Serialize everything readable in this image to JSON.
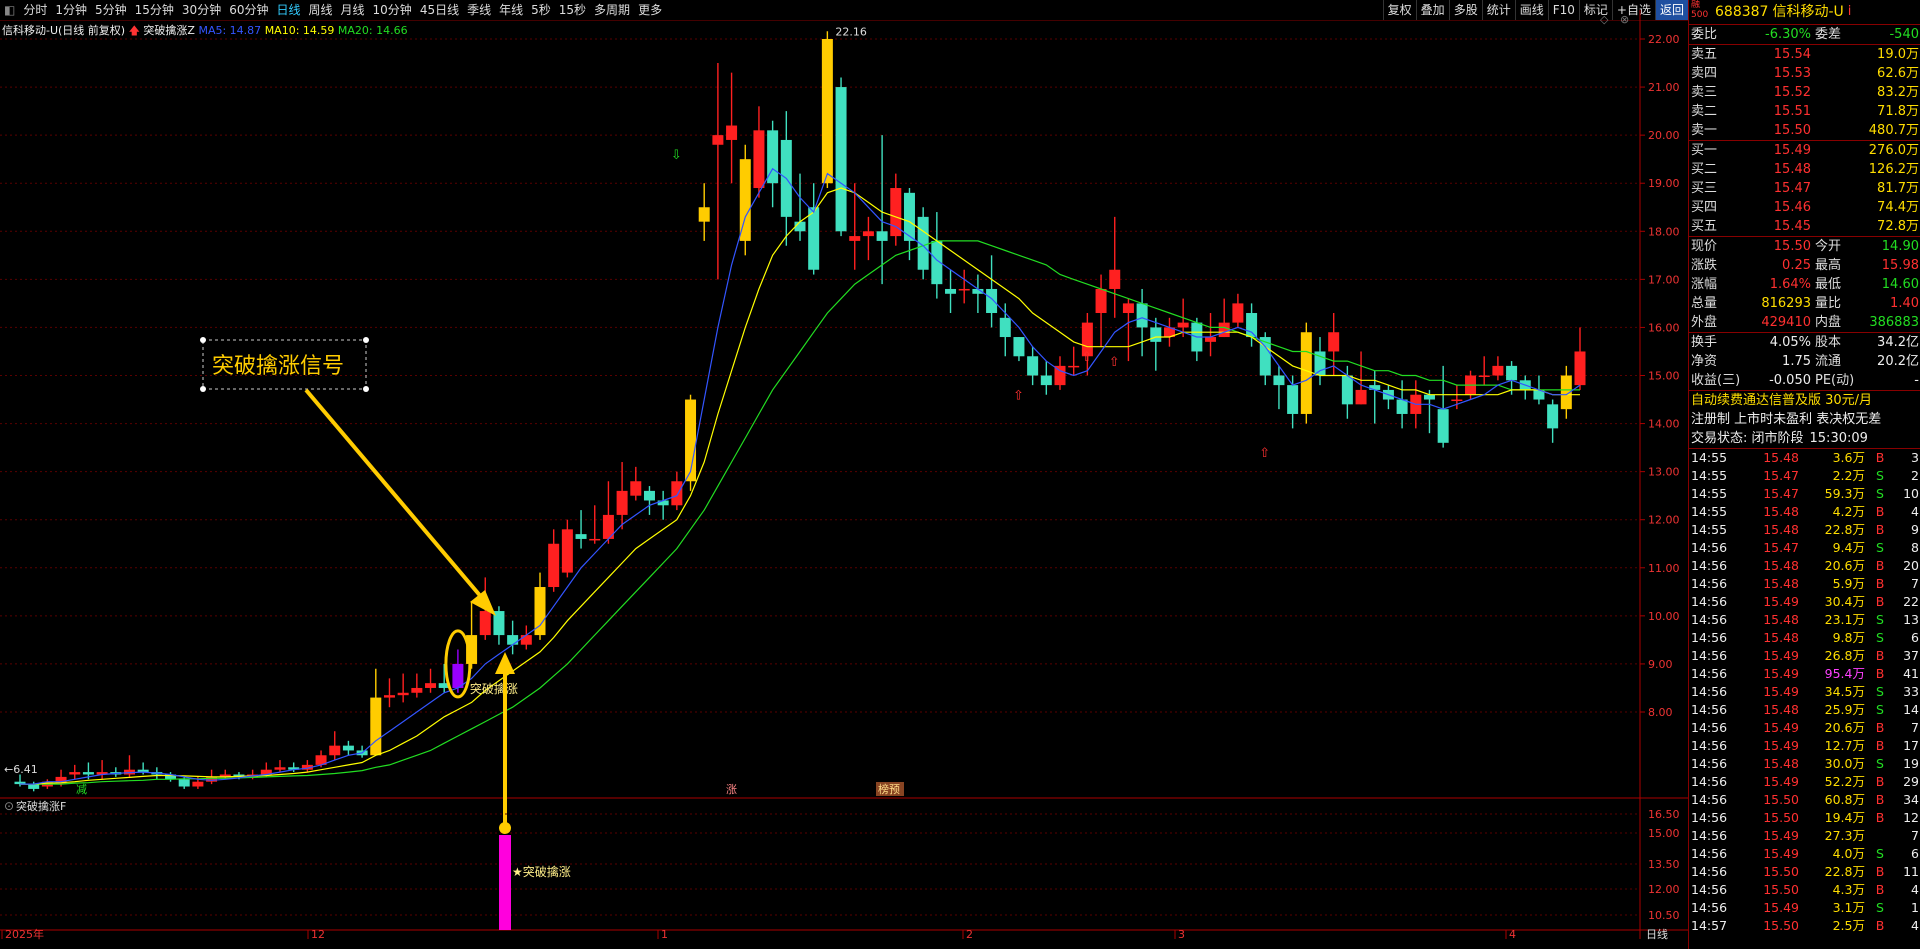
{
  "toolbar": {
    "tabs": [
      "分时",
      "1分钟",
      "5分钟",
      "15分钟",
      "30分钟",
      "60分钟",
      "日线",
      "周线",
      "月线",
      "10分钟",
      "45日线",
      "季线",
      "年线",
      "5秒",
      "15秒",
      "多周期",
      "更多"
    ],
    "active_tab": "日线",
    "right_buttons": [
      "复权",
      "叠加",
      "多股",
      "统计",
      "画线",
      "F10",
      "标记",
      "+自选",
      "返回"
    ]
  },
  "legend": {
    "title": "信科移动-U(日线 前复权)",
    "indicator": "突破擒涨Z",
    "ma5": "MA5: 14.87",
    "ma10": "MA10: 14.59",
    "ma20": "MA20: 14.66",
    "colors": {
      "ma5": "#3355ff",
      "ma10": "#ffff00",
      "ma20": "#22dd22"
    }
  },
  "chart_data": {
    "type": "candlestick",
    "y_ticks": [
      "22.00",
      "21.00",
      "20.00",
      "19.00",
      "18.00",
      "17.00",
      "16.00",
      "15.00",
      "14.00",
      "13.00",
      "12.00",
      "11.00",
      "10.00",
      "9.00",
      "8.00"
    ],
    "ylim": [
      7.0,
      22.3
    ],
    "x_labels": [
      "2025年",
      "12",
      "1",
      "2",
      "3",
      "4"
    ],
    "high_label": "22.16",
    "low_label": "6.41",
    "annotation_box": "突破擒涨信号",
    "signal_label": "突破擒涨",
    "bottom_markers": [
      "减",
      "涨",
      "榜预"
    ],
    "candles": [
      [
        6.55,
        6.5,
        6.45,
        6.7
      ],
      [
        6.5,
        6.4,
        6.35,
        6.55
      ],
      [
        6.45,
        6.55,
        6.4,
        6.6
      ],
      [
        6.5,
        6.65,
        6.45,
        6.8
      ],
      [
        6.7,
        6.75,
        6.6,
        6.9
      ],
      [
        6.75,
        6.7,
        6.6,
        6.95
      ],
      [
        6.7,
        6.75,
        6.6,
        7.0
      ],
      [
        6.75,
        6.7,
        6.65,
        6.85
      ],
      [
        6.7,
        6.8,
        6.65,
        7.1
      ],
      [
        6.8,
        6.75,
        6.7,
        6.95
      ],
      [
        6.75,
        6.7,
        6.6,
        6.85
      ],
      [
        6.7,
        6.6,
        6.55,
        6.75
      ],
      [
        6.6,
        6.45,
        6.4,
        6.65
      ],
      [
        6.45,
        6.55,
        6.4,
        6.65
      ],
      [
        6.55,
        6.65,
        6.5,
        6.8
      ],
      [
        6.65,
        6.7,
        6.6,
        6.8
      ],
      [
        6.7,
        6.65,
        6.6,
        6.75
      ],
      [
        6.65,
        6.7,
        6.6,
        6.8
      ],
      [
        6.7,
        6.8,
        6.65,
        6.95
      ],
      [
        6.8,
        6.85,
        6.75,
        7.0
      ],
      [
        6.85,
        6.8,
        6.75,
        6.95
      ],
      [
        6.8,
        6.9,
        6.75,
        7.0
      ],
      [
        6.9,
        7.1,
        6.85,
        7.2
      ],
      [
        7.1,
        7.3,
        7.0,
        7.6
      ],
      [
        7.3,
        7.2,
        7.1,
        7.4
      ],
      [
        7.2,
        7.1,
        7.05,
        7.3
      ],
      [
        7.1,
        8.3,
        7.1,
        8.9
      ],
      [
        8.3,
        8.35,
        8.1,
        8.7
      ],
      [
        8.35,
        8.4,
        8.2,
        8.8
      ],
      [
        8.4,
        8.5,
        8.3,
        8.8
      ],
      [
        8.5,
        8.6,
        8.4,
        8.9
      ],
      [
        8.6,
        8.5,
        8.4,
        9.0
      ],
      [
        8.5,
        9.0,
        8.4,
        9.3
      ],
      [
        9.0,
        9.6,
        8.9,
        10.3
      ],
      [
        9.6,
        10.1,
        9.5,
        10.8
      ],
      [
        10.1,
        9.6,
        9.4,
        10.2
      ],
      [
        9.6,
        9.4,
        9.2,
        9.9
      ],
      [
        9.4,
        9.6,
        9.3,
        9.8
      ],
      [
        9.6,
        10.6,
        9.5,
        10.9
      ],
      [
        10.6,
        11.5,
        10.5,
        11.8
      ],
      [
        10.9,
        11.8,
        10.8,
        12.0
      ],
      [
        11.7,
        11.6,
        11.4,
        12.2
      ],
      [
        11.6,
        11.6,
        11.5,
        12.3
      ],
      [
        11.6,
        12.1,
        11.5,
        12.8
      ],
      [
        12.1,
        12.6,
        11.8,
        13.2
      ],
      [
        12.5,
        12.8,
        12.4,
        13.1
      ],
      [
        12.6,
        12.4,
        12.1,
        12.7
      ],
      [
        12.4,
        12.3,
        12.0,
        12.6
      ],
      [
        12.3,
        12.8,
        12.2,
        13.0
      ],
      [
        12.8,
        14.5,
        12.6,
        14.6
      ],
      [
        18.2,
        18.5,
        17.8,
        19.0
      ],
      [
        19.8,
        20.0,
        17.0,
        21.5
      ],
      [
        19.9,
        20.2,
        19.0,
        21.3
      ],
      [
        19.5,
        17.8,
        17.5,
        19.8
      ],
      [
        18.9,
        20.1,
        18.7,
        20.6
      ],
      [
        20.1,
        19.0,
        18.5,
        20.3
      ],
      [
        19.9,
        18.3,
        17.7,
        20.5
      ],
      [
        18.2,
        18.0,
        17.8,
        19.2
      ],
      [
        18.5,
        17.2,
        17.1,
        19.0
      ],
      [
        19.0,
        22.0,
        18.9,
        22.16
      ],
      [
        21.0,
        18.0,
        17.9,
        21.2
      ],
      [
        17.8,
        17.9,
        17.2,
        19.0
      ],
      [
        17.9,
        18.0,
        17.4,
        18.3
      ],
      [
        18.0,
        17.8,
        16.9,
        20.0
      ],
      [
        17.9,
        18.9,
        17.7,
        19.2
      ],
      [
        18.8,
        17.8,
        17.4,
        18.9
      ],
      [
        18.3,
        17.2,
        17.0,
        18.5
      ],
      [
        17.8,
        16.9,
        16.6,
        18.4
      ],
      [
        16.8,
        16.7,
        16.3,
        17.2
      ],
      [
        16.8,
        16.8,
        16.5,
        17.2
      ],
      [
        16.8,
        16.7,
        16.3,
        17.1
      ],
      [
        16.8,
        16.3,
        16.0,
        17.5
      ],
      [
        16.2,
        15.8,
        15.4,
        16.5
      ],
      [
        15.8,
        15.4,
        15.3,
        15.8
      ],
      [
        15.4,
        15.0,
        14.8,
        15.6
      ],
      [
        15.0,
        14.8,
        14.6,
        15.3
      ],
      [
        14.8,
        15.2,
        14.7,
        15.4
      ],
      [
        15.2,
        15.2,
        15.0,
        15.6
      ],
      [
        15.4,
        16.1,
        15.0,
        16.3
      ],
      [
        16.3,
        16.8,
        15.6,
        17.1
      ],
      [
        16.8,
        17.2,
        16.2,
        18.3
      ],
      [
        16.3,
        16.5,
        15.3,
        16.6
      ],
      [
        16.5,
        16.0,
        15.4,
        16.8
      ],
      [
        16.0,
        15.7,
        15.1,
        16.2
      ],
      [
        15.8,
        16.0,
        15.6,
        16.2
      ],
      [
        16.0,
        16.1,
        15.8,
        16.6
      ],
      [
        16.1,
        15.5,
        15.3,
        16.2
      ],
      [
        15.7,
        15.8,
        15.4,
        16.3
      ],
      [
        15.8,
        16.1,
        15.8,
        16.6
      ],
      [
        16.1,
        16.5,
        16.0,
        16.7
      ],
      [
        16.3,
        15.8,
        15.6,
        16.5
      ],
      [
        15.8,
        15.0,
        14.8,
        15.9
      ],
      [
        15.0,
        14.8,
        14.3,
        15.2
      ],
      [
        14.8,
        14.2,
        13.9,
        15.0
      ],
      [
        14.2,
        15.9,
        14.0,
        16.1
      ],
      [
        15.5,
        15.0,
        14.8,
        15.8
      ],
      [
        15.5,
        15.9,
        15.0,
        16.3
      ],
      [
        15.0,
        14.4,
        14.1,
        15.2
      ],
      [
        14.4,
        14.7,
        14.4,
        15.5
      ],
      [
        14.8,
        14.7,
        14.0,
        15.1
      ],
      [
        14.7,
        14.5,
        14.3,
        14.8
      ],
      [
        14.5,
        14.2,
        13.9,
        14.9
      ],
      [
        14.2,
        14.6,
        13.9,
        14.9
      ],
      [
        14.6,
        14.5,
        13.8,
        14.7
      ],
      [
        14.3,
        13.6,
        13.5,
        15.2
      ],
      [
        14.5,
        14.5,
        14.3,
        14.8
      ],
      [
        14.6,
        15.0,
        14.5,
        15.1
      ],
      [
        15.0,
        15.0,
        14.8,
        15.4
      ],
      [
        15.0,
        15.2,
        14.9,
        15.4
      ],
      [
        15.2,
        14.9,
        14.6,
        15.3
      ],
      [
        14.9,
        14.7,
        14.5,
        15.0
      ],
      [
        14.7,
        14.5,
        14.4,
        15.0
      ],
      [
        14.4,
        13.9,
        13.6,
        14.5
      ],
      [
        14.3,
        15.0,
        14.1,
        15.2
      ],
      [
        14.8,
        15.5,
        14.7,
        16.0
      ]
    ],
    "ma5_path": [
      6.5,
      6.5,
      6.55,
      6.55,
      6.6,
      6.65,
      6.7,
      6.72,
      6.74,
      6.75,
      6.73,
      6.7,
      6.65,
      6.6,
      6.58,
      6.6,
      6.63,
      6.67,
      6.7,
      6.75,
      6.8,
      6.83,
      6.9,
      7.0,
      7.1,
      7.15,
      7.4,
      7.6,
      7.8,
      8.0,
      8.2,
      8.4,
      8.5,
      8.7,
      9.0,
      9.2,
      9.4,
      9.6,
      9.8,
      10.2,
      10.6,
      11.0,
      11.3,
      11.6,
      11.9,
      12.1,
      12.3,
      12.4,
      12.5,
      13.0,
      14.5,
      16.0,
      17.3,
      18.3,
      18.8,
      19.3,
      19.1,
      18.7,
      18.4,
      19.2,
      19.0,
      18.8,
      18.5,
      18.2,
      18.1,
      17.9,
      17.7,
      17.4,
      17.2,
      17.0,
      16.8,
      16.6,
      16.3,
      16.0,
      15.6,
      15.3,
      15.1,
      15.0,
      15.1,
      15.5,
      15.9,
      16.1,
      16.2,
      16.1,
      16.0,
      15.9,
      15.8,
      15.8,
      15.9,
      16.0,
      15.9,
      15.6,
      15.2,
      14.8,
      14.9,
      15.1,
      15.2,
      15.0,
      14.8,
      14.7,
      14.6,
      14.5,
      14.4,
      14.4,
      14.3,
      14.4,
      14.5,
      14.6,
      14.8,
      14.9,
      14.8,
      14.7,
      14.6,
      14.6,
      14.8
    ],
    "ma10_path": [
      6.5,
      6.5,
      6.52,
      6.53,
      6.55,
      6.58,
      6.6,
      6.62,
      6.64,
      6.66,
      6.68,
      6.68,
      6.67,
      6.66,
      6.65,
      6.65,
      6.66,
      6.67,
      6.68,
      6.7,
      6.72,
      6.75,
      6.8,
      6.85,
      6.9,
      6.95,
      7.1,
      7.2,
      7.35,
      7.5,
      7.7,
      7.9,
      8.05,
      8.2,
      8.45,
      8.65,
      8.85,
      9.05,
      9.25,
      9.55,
      9.9,
      10.2,
      10.5,
      10.8,
      11.1,
      11.4,
      11.6,
      11.8,
      12.0,
      12.5,
      13.2,
      14.2,
      15.1,
      16.0,
      16.8,
      17.5,
      17.9,
      18.2,
      18.4,
      18.8,
      18.9,
      18.8,
      18.6,
      18.4,
      18.3,
      18.2,
      18.0,
      17.8,
      17.6,
      17.4,
      17.2,
      17.0,
      16.8,
      16.6,
      16.3,
      16.1,
      15.9,
      15.7,
      15.6,
      15.6,
      15.6,
      15.6,
      15.7,
      15.8,
      15.8,
      15.9,
      15.9,
      15.9,
      15.9,
      15.9,
      15.8,
      15.6,
      15.4,
      15.2,
      15.1,
      15.0,
      15.0,
      15.0,
      14.9,
      14.9,
      14.8,
      14.7,
      14.7,
      14.6,
      14.6,
      14.6,
      14.6,
      14.6,
      14.6,
      14.7,
      14.7,
      14.7,
      14.6,
      14.6,
      14.6
    ],
    "ma20_path": [
      6.5,
      6.5,
      6.5,
      6.5,
      6.52,
      6.53,
      6.55,
      6.56,
      6.57,
      6.58,
      6.6,
      6.6,
      6.61,
      6.61,
      6.62,
      6.62,
      6.63,
      6.64,
      6.65,
      6.66,
      6.67,
      6.68,
      6.7,
      6.72,
      6.75,
      6.78,
      6.85,
      6.9,
      7.0,
      7.1,
      7.2,
      7.35,
      7.5,
      7.65,
      7.8,
      7.95,
      8.1,
      8.3,
      8.5,
      8.75,
      9.0,
      9.3,
      9.6,
      9.9,
      10.2,
      10.5,
      10.8,
      11.1,
      11.4,
      11.8,
      12.2,
      12.7,
      13.2,
      13.7,
      14.2,
      14.7,
      15.1,
      15.5,
      15.9,
      16.3,
      16.6,
      16.9,
      17.1,
      17.3,
      17.5,
      17.6,
      17.7,
      17.8,
      17.8,
      17.8,
      17.8,
      17.7,
      17.6,
      17.5,
      17.4,
      17.3,
      17.1,
      17.0,
      16.9,
      16.8,
      16.7,
      16.6,
      16.5,
      16.4,
      16.3,
      16.2,
      16.1,
      16.0,
      16.0,
      15.9,
      15.8,
      15.7,
      15.6,
      15.5,
      15.5,
      15.4,
      15.3,
      15.3,
      15.2,
      15.1,
      15.1,
      15.0,
      15.0,
      14.9,
      14.9,
      14.8,
      14.8,
      14.8,
      14.8,
      14.7,
      14.7,
      14.7,
      14.7,
      14.7,
      14.7
    ]
  },
  "sub_indicator": {
    "name": "突破擒涨F",
    "y_ticks": [
      "16.50",
      "15.00",
      "13.50",
      "12.00",
      "10.50"
    ],
    "signal_label": "突破擒涨",
    "period_label": "日线"
  },
  "quote": {
    "logo": "融 500",
    "code": "688387",
    "name": "信科移动-U",
    "weibi_label": "委比",
    "weibi": "-6.30%",
    "weicha_label": "委差",
    "weicha": "-540",
    "asks": [
      {
        "label": "卖五",
        "price": "15.54",
        "vol": "19.0万"
      },
      {
        "label": "卖四",
        "price": "15.53",
        "vol": "62.6万"
      },
      {
        "label": "卖三",
        "price": "15.52",
        "vol": "83.2万"
      },
      {
        "label": "卖二",
        "price": "15.51",
        "vol": "71.8万"
      },
      {
        "label": "卖一",
        "price": "15.50",
        "vol": "480.7万"
      }
    ],
    "bids": [
      {
        "label": "买一",
        "price": "15.49",
        "vol": "276.0万"
      },
      {
        "label": "买二",
        "price": "15.48",
        "vol": "126.2万"
      },
      {
        "label": "买三",
        "price": "15.47",
        "vol": "81.7万"
      },
      {
        "label": "买四",
        "price": "15.46",
        "vol": "74.4万"
      },
      {
        "label": "买五",
        "price": "15.45",
        "vol": "72.8万"
      }
    ],
    "stats": [
      {
        "l1": "现价",
        "v1": "15.50",
        "c1": "red",
        "l2": "今开",
        "v2": "14.90",
        "c2": "green"
      },
      {
        "l1": "涨跌",
        "v1": "0.25",
        "c1": "red",
        "l2": "最高",
        "v2": "15.98",
        "c2": "red"
      },
      {
        "l1": "涨幅",
        "v1": "1.64%",
        "c1": "red",
        "l2": "最低",
        "v2": "14.60",
        "c2": "green"
      },
      {
        "l1": "总量",
        "v1": "816293",
        "c1": "yellow",
        "l2": "量比",
        "v2": "1.40",
        "c2": "red"
      },
      {
        "l1": "外盘",
        "v1": "429410",
        "c1": "red",
        "l2": "内盘",
        "v2": "386883",
        "c2": "green"
      }
    ],
    "stats2": [
      {
        "l1": "换手",
        "v1": "4.05%",
        "l2": "股本",
        "v2": "34.2亿"
      },
      {
        "l1": "净资",
        "v1": "1.75",
        "l2": "流通",
        "v2": "20.2亿"
      },
      {
        "l1": "收益(三)",
        "v1": "-0.050",
        "l2": "PE(动)",
        "v2": "-"
      }
    ],
    "promo": "自动续费通达信普及版  30元/月",
    "notice": "注册制 上市时未盈利 表决权无差",
    "trade_status_label": "交易状态: 闭市阶段",
    "trade_status_time": "15:30:09"
  },
  "ticks": [
    {
      "t": "14:55",
      "p": "15.48",
      "v": "3.6万",
      "bs": "B",
      "n": "3"
    },
    {
      "t": "14:55",
      "p": "15.47",
      "v": "2.2万",
      "bs": "S",
      "n": "2"
    },
    {
      "t": "14:55",
      "p": "15.47",
      "v": "59.3万",
      "bs": "S",
      "n": "10"
    },
    {
      "t": "14:55",
      "p": "15.48",
      "v": "4.2万",
      "bs": "B",
      "n": "4"
    },
    {
      "t": "14:55",
      "p": "15.48",
      "v": "22.8万",
      "bs": "B",
      "n": "9"
    },
    {
      "t": "14:56",
      "p": "15.47",
      "v": "9.4万",
      "bs": "S",
      "n": "8"
    },
    {
      "t": "14:56",
      "p": "15.48",
      "v": "20.6万",
      "bs": "B",
      "n": "20"
    },
    {
      "t": "14:56",
      "p": "15.48",
      "v": "5.9万",
      "bs": "B",
      "n": "7"
    },
    {
      "t": "14:56",
      "p": "15.49",
      "v": "30.4万",
      "bs": "B",
      "n": "22"
    },
    {
      "t": "14:56",
      "p": "15.48",
      "v": "23.1万",
      "bs": "S",
      "n": "13"
    },
    {
      "t": "14:56",
      "p": "15.48",
      "v": "9.8万",
      "bs": "S",
      "n": "6"
    },
    {
      "t": "14:56",
      "p": "15.49",
      "v": "26.8万",
      "bs": "B",
      "n": "37"
    },
    {
      "t": "14:56",
      "p": "15.49",
      "v": "95.4万",
      "bs": "B",
      "n": "41"
    },
    {
      "t": "14:56",
      "p": "15.49",
      "v": "34.5万",
      "bs": "S",
      "n": "33"
    },
    {
      "t": "14:56",
      "p": "15.48",
      "v": "25.9万",
      "bs": "S",
      "n": "14"
    },
    {
      "t": "14:56",
      "p": "15.49",
      "v": "20.6万",
      "bs": "B",
      "n": "7"
    },
    {
      "t": "14:56",
      "p": "15.49",
      "v": "12.7万",
      "bs": "B",
      "n": "17"
    },
    {
      "t": "14:56",
      "p": "15.48",
      "v": "30.0万",
      "bs": "S",
      "n": "19"
    },
    {
      "t": "14:56",
      "p": "15.49",
      "v": "52.2万",
      "bs": "B",
      "n": "29"
    },
    {
      "t": "14:56",
      "p": "15.50",
      "v": "60.8万",
      "bs": "B",
      "n": "34"
    },
    {
      "t": "14:56",
      "p": "15.50",
      "v": "19.4万",
      "bs": "B",
      "n": "12"
    },
    {
      "t": "14:56",
      "p": "15.49",
      "v": "27.3万",
      "bs": "",
      "n": "7"
    },
    {
      "t": "14:56",
      "p": "15.49",
      "v": "4.0万",
      "bs": "S",
      "n": "6"
    },
    {
      "t": "14:56",
      "p": "15.50",
      "v": "22.8万",
      "bs": "B",
      "n": "11"
    },
    {
      "t": "14:56",
      "p": "15.50",
      "v": "4.3万",
      "bs": "B",
      "n": "4"
    },
    {
      "t": "14:56",
      "p": "15.49",
      "v": "3.1万",
      "bs": "S",
      "n": "1"
    },
    {
      "t": "14:57",
      "p": "15.50",
      "v": "2.5万",
      "bs": "B",
      "n": "4"
    }
  ]
}
